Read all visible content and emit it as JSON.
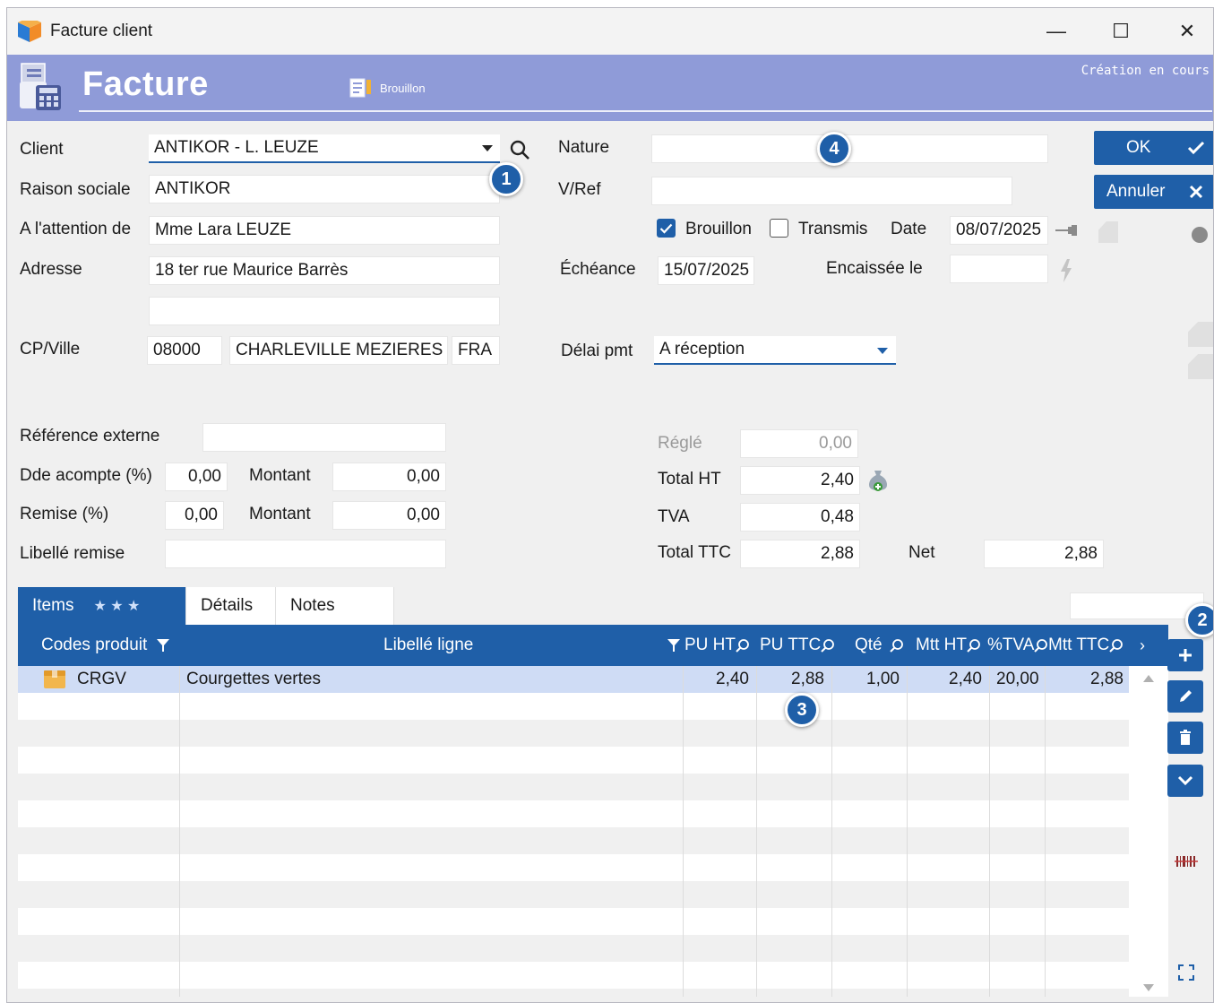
{
  "window": {
    "title": "Facture client",
    "minimize": "—",
    "maximize": "☐",
    "close": "✕"
  },
  "banner": {
    "title": "Facture",
    "badge": "Brouillon",
    "status": "Création en cours"
  },
  "labels": {
    "client": "Client",
    "raison_sociale": "Raison sociale",
    "attention": "A l'attention de",
    "adresse": "Adresse",
    "cp_ville": "CP/Ville",
    "nature": "Nature",
    "vref": "V/Ref",
    "brouillon": "Brouillon",
    "transmis": "Transmis",
    "date": "Date",
    "echeance": "Échéance",
    "encaissee": "Encaissée le",
    "delai": "Délai pmt",
    "ref_externe": "Référence externe",
    "acompte": "Dde acompte (%)",
    "montant": "Montant",
    "remise": "Remise (%)",
    "libelle_remise": "Libellé remise",
    "regle": "Réglé",
    "total_ht": "Total HT",
    "tva": "TVA",
    "total_ttc": "Total TTC",
    "net": "Net"
  },
  "fields": {
    "client": "ANTIKOR - L. LEUZE",
    "raison_sociale": "ANTIKOR",
    "attention": "Mme Lara LEUZE",
    "adresse1": "18 ter rue Maurice Barrès",
    "adresse2": "",
    "cp": "08000",
    "ville": "CHARLEVILLE MEZIERES",
    "pays": "FRA",
    "nature": "",
    "vref": "",
    "date": "08/07/2025",
    "echeance": "15/07/2025",
    "encaissee": "",
    "delai": "A réception",
    "ref_externe": "",
    "acompte_pct": "0,00",
    "acompte_montant": "0,00",
    "remise_pct": "0,00",
    "remise_montant": "0,00",
    "libelle_remise": "",
    "regle": "0,00",
    "total_ht": "2,40",
    "tva": "0,48",
    "total_ttc": "2,88",
    "net": "2,88"
  },
  "checkboxes": {
    "brouillon": true,
    "transmis": false
  },
  "buttons": {
    "ok": "OK",
    "annuler": "Annuler"
  },
  "badges": [
    "1",
    "2",
    "3",
    "4"
  ],
  "tabs": [
    {
      "label": "Items",
      "active": true
    },
    {
      "label": "Détails"
    },
    {
      "label": "Notes"
    }
  ],
  "tab_stars": "★ ★ ★",
  "grid": {
    "columns": [
      "Codes produit",
      "Libellé ligne",
      "PU HT",
      "PU TTC",
      "Qté",
      "Mtt HT",
      "%TVA",
      "Mtt TTC"
    ],
    "rows": [
      {
        "code": "CRGV",
        "libelle": "Courgettes vertes",
        "pu_ht": "2,40",
        "pu_ttc": "2,88",
        "qte": "1,00",
        "mtt_ht": "2,40",
        "tva": "20,00",
        "mtt_ttc": "2,88"
      }
    ]
  },
  "colors": {
    "accent": "#1f5fa8",
    "banner": "#8f9bd8",
    "selected_row": "#cfdcf5"
  },
  "icons": [
    "app-logo-icon",
    "invoice-calculator-icon",
    "draft-icon",
    "dropdown-arrow-icon",
    "search-icon",
    "check-icon",
    "close-x-icon",
    "pin-icon",
    "lightning-icon",
    "money-bag-icon",
    "filter-icon",
    "magnifier-icon",
    "box-icon",
    "plus-icon",
    "pencil-icon",
    "trash-icon",
    "chevron-down-icon",
    "barcode-icon",
    "expand-icon"
  ]
}
